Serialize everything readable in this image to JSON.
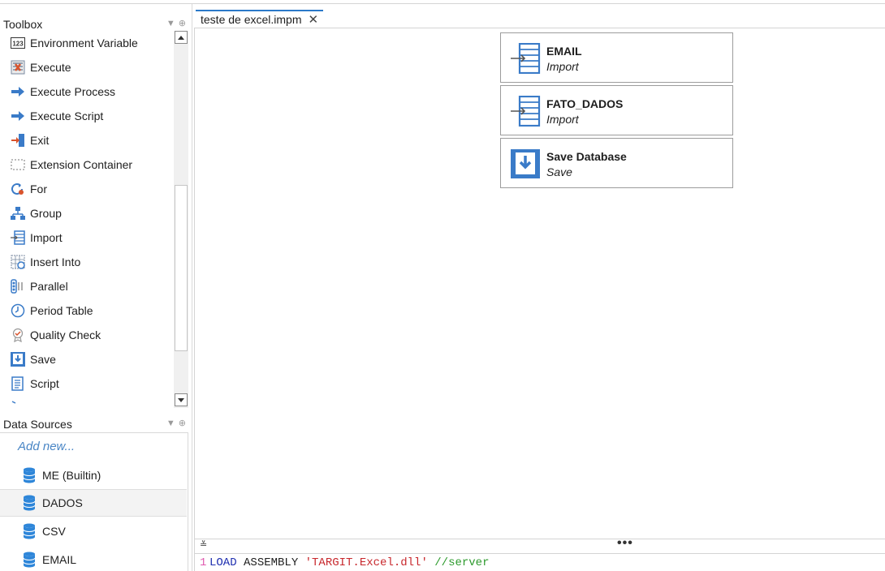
{
  "toolbox": {
    "title": "Toolbox",
    "items": [
      {
        "label": "Environment Variable",
        "icon": "env-variable-icon"
      },
      {
        "label": "Execute",
        "icon": "execute-icon"
      },
      {
        "label": "Execute Process",
        "icon": "execute-process-icon"
      },
      {
        "label": "Execute Script",
        "icon": "execute-script-icon"
      },
      {
        "label": "Exit",
        "icon": "exit-icon"
      },
      {
        "label": "Extension Container",
        "icon": "extension-container-icon"
      },
      {
        "label": "For",
        "icon": "for-icon"
      },
      {
        "label": "Group",
        "icon": "group-icon"
      },
      {
        "label": "Import",
        "icon": "import-icon"
      },
      {
        "label": "Insert Into",
        "icon": "insert-into-icon"
      },
      {
        "label": "Parallel",
        "icon": "parallel-icon"
      },
      {
        "label": "Period Table",
        "icon": "period-table-icon"
      },
      {
        "label": "Quality Check",
        "icon": "quality-check-icon"
      },
      {
        "label": "Save",
        "icon": "save-icon"
      },
      {
        "label": "Script",
        "icon": "script-icon"
      }
    ]
  },
  "data_sources": {
    "title": "Data Sources",
    "add_new": "Add new...",
    "items": [
      {
        "label": "ME (Builtin)",
        "selected": false
      },
      {
        "label": "DADOS",
        "selected": true
      },
      {
        "label": "CSV",
        "selected": false
      },
      {
        "label": "EMAIL",
        "selected": false
      }
    ]
  },
  "editor": {
    "tab_label": "teste de excel.impm",
    "nodes": [
      {
        "title": "EMAIL",
        "subtitle": "Import",
        "icon": "import-icon"
      },
      {
        "title": "FATO_DADOS",
        "subtitle": "Import",
        "icon": "import-icon"
      },
      {
        "title": "Save Database",
        "subtitle": "Save",
        "icon": "save-icon"
      }
    ]
  },
  "script": {
    "line_number": "1",
    "keyword": "LOAD",
    "text": " ASSEMBLY ",
    "string": "'TARGIT.Excel.dll'",
    "comment": " //server"
  },
  "colors": {
    "accent": "#2b79c9",
    "icon_blue": "#3a7bc8",
    "link": "#4a86c5"
  }
}
